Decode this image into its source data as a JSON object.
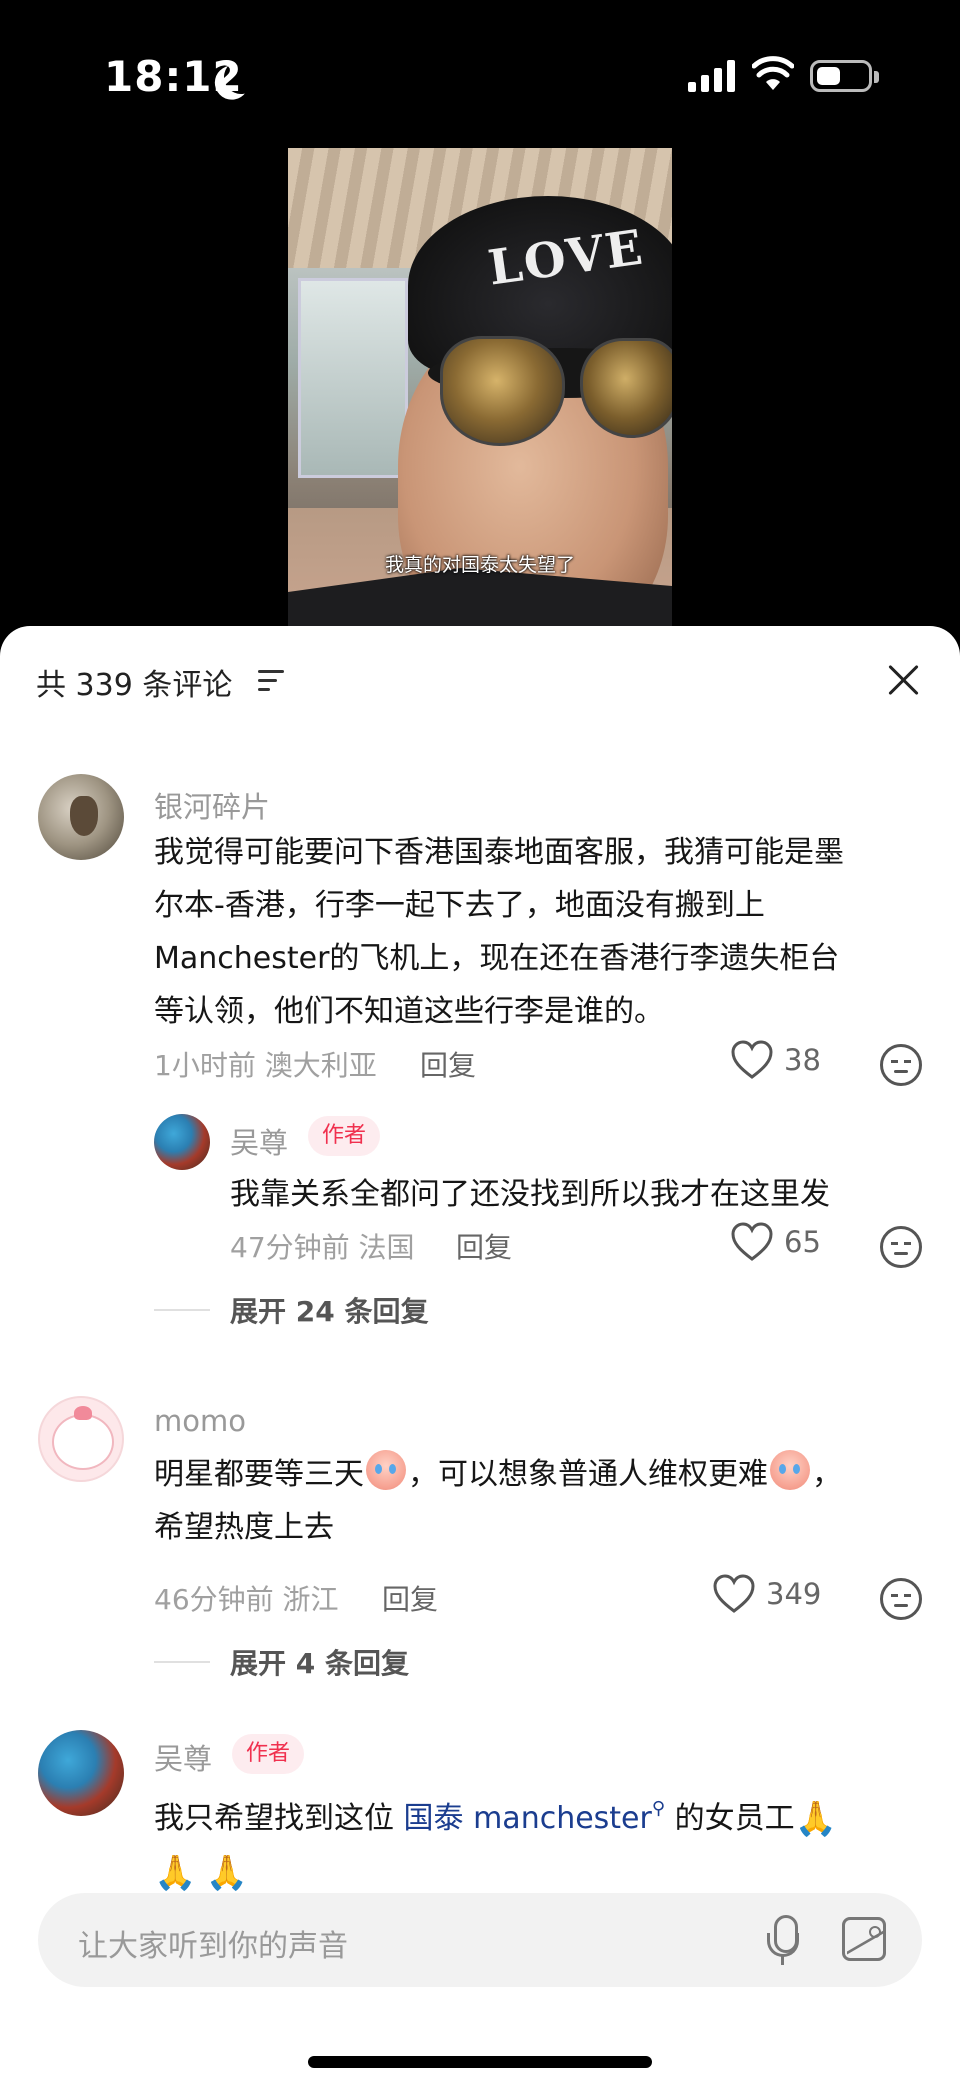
{
  "status_bar": {
    "time": "18:12",
    "battery_level": 0.45
  },
  "video": {
    "cap_text": "LOVE",
    "subtitle": "我真的对国泰太失望了"
  },
  "comments_panel": {
    "title": "共 339 条评论",
    "input_placeholder": "让大家听到你的声音"
  },
  "comments": [
    {
      "user": "银河碎片",
      "text_lines": [
        "我觉得可能要问下香港国泰地面客服，我猜可能是墨",
        "尔本-香港，行李一起下去了，地面没有搬到上",
        "Manchester的飞机上，现在还在香港行李遗失柜台",
        "等认领，他们不知道这些行李是谁的。"
      ],
      "meta": "1小时前 澳大利亚",
      "reply_label": "回复",
      "likes": "38"
    },
    {
      "user": "吴尊",
      "badge": "作者",
      "text": "我靠关系全都问了还没找到所以我才在这里发",
      "meta": "47分钟前 法国",
      "reply_label": "回复",
      "likes": "65",
      "expand": "展开 24 条回复"
    },
    {
      "user": "momo",
      "text_a": "明星都要等三天",
      "text_b": "，可以想象普通人维权更难",
      "text_c": "，",
      "text_line2": "希望热度上去",
      "meta": "46分钟前 浙江",
      "reply_label": "回复",
      "likes": "349",
      "expand": "展开 4 条回复"
    },
    {
      "user": "吴尊",
      "badge": "作者",
      "text_prefix": "我只希望找到这位 ",
      "link": "国泰 manchester",
      "text_suffix": " 的女员工"
    }
  ],
  "icons": [
    "moon-icon",
    "signal-icon",
    "wifi-icon",
    "battery-icon",
    "sort-icon",
    "close-icon",
    "heart-icon",
    "dislike-icon",
    "mic-icon",
    "image-icon"
  ],
  "colors": {
    "badge_text": "#f0304e",
    "badge_bg": "#fdecef",
    "link": "#1b3d8f"
  }
}
